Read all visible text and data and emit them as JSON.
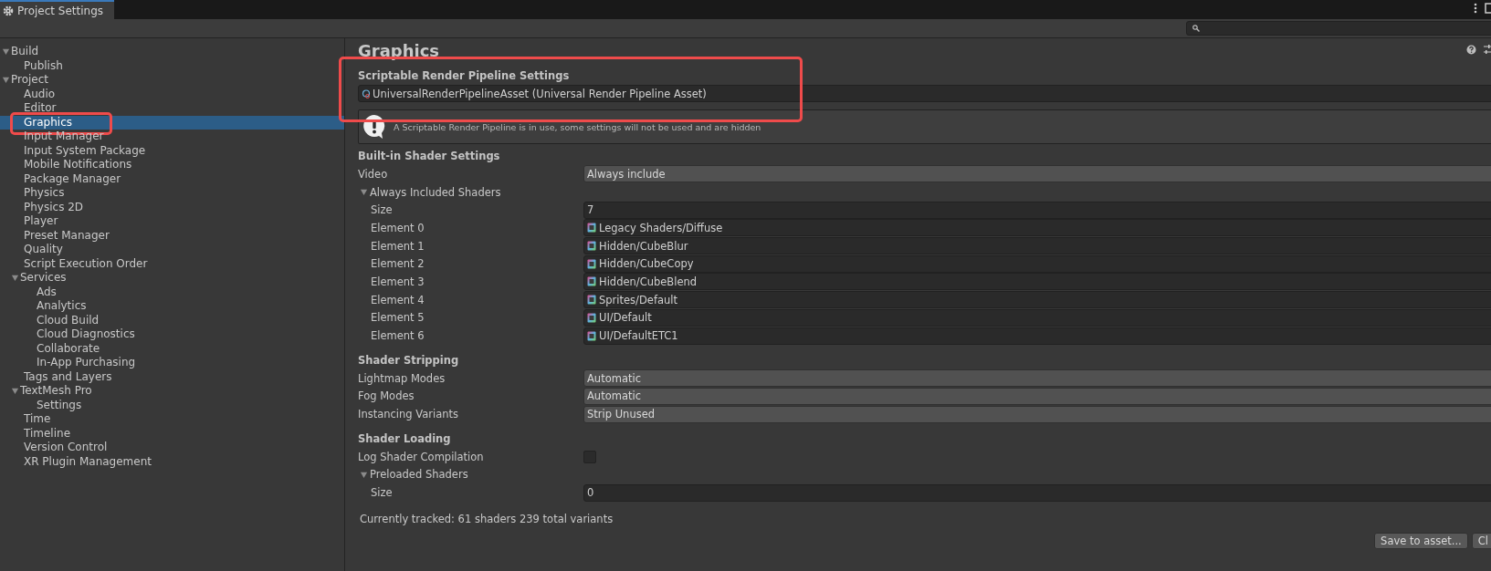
{
  "window": {
    "tab_title": "Project Settings"
  },
  "sidebar": {
    "items": [
      {
        "label": "Build",
        "expanded": true,
        "selected": false,
        "annotated": false,
        "children": [
          {
            "label": "Publish",
            "selected": false,
            "annotated": false
          }
        ]
      },
      {
        "label": "Project",
        "expanded": true,
        "selected": false,
        "annotated": false,
        "children": [
          {
            "label": "Audio",
            "selected": false,
            "annotated": false
          },
          {
            "label": "Editor",
            "selected": false,
            "annotated": false
          },
          {
            "label": "Graphics",
            "selected": true,
            "annotated": true
          },
          {
            "label": "Input Manager",
            "selected": false,
            "annotated": false
          },
          {
            "label": "Input System Package",
            "selected": false,
            "annotated": false
          },
          {
            "label": "Mobile Notifications",
            "selected": false,
            "annotated": false
          },
          {
            "label": "Package Manager",
            "selected": false,
            "annotated": false
          },
          {
            "label": "Physics",
            "selected": false,
            "annotated": false
          },
          {
            "label": "Physics 2D",
            "selected": false,
            "annotated": false
          },
          {
            "label": "Player",
            "selected": false,
            "annotated": false
          },
          {
            "label": "Preset Manager",
            "selected": false,
            "annotated": false
          },
          {
            "label": "Quality",
            "selected": false,
            "annotated": false
          },
          {
            "label": "Script Execution Order",
            "selected": false,
            "annotated": false
          },
          {
            "label": "Services",
            "expanded": true,
            "selected": false,
            "annotated": false,
            "children": [
              {
                "label": "Ads",
                "selected": false,
                "annotated": false
              },
              {
                "label": "Analytics",
                "selected": false,
                "annotated": false
              },
              {
                "label": "Cloud Build",
                "selected": false,
                "annotated": false
              },
              {
                "label": "Cloud Diagnostics",
                "selected": false,
                "annotated": false
              },
              {
                "label": "Collaborate",
                "selected": false,
                "annotated": false
              },
              {
                "label": "In-App Purchasing",
                "selected": false,
                "annotated": false
              }
            ]
          },
          {
            "label": "Tags and Layers",
            "selected": false,
            "annotated": false
          },
          {
            "label": "TextMesh Pro",
            "expanded": true,
            "selected": false,
            "annotated": false,
            "children": [
              {
                "label": "Settings",
                "selected": false,
                "annotated": false
              }
            ]
          },
          {
            "label": "Time",
            "selected": false,
            "annotated": false
          },
          {
            "label": "Timeline",
            "selected": false,
            "annotated": false
          },
          {
            "label": "Version Control",
            "selected": false,
            "annotated": false
          },
          {
            "label": "XR Plugin Management",
            "selected": false,
            "annotated": false
          }
        ]
      }
    ]
  },
  "main": {
    "title": "Graphics",
    "pipeline": {
      "heading": "Scriptable Render Pipeline Settings",
      "asset": "UniversalRenderPipelineAsset (Universal Render Pipeline Asset)",
      "annotated": true
    },
    "info_box": {
      "message": "A Scriptable Render Pipeline is in use, some settings will not be used and are hidden"
    },
    "sections": [
      {
        "heading": "Built-in Shader Settings",
        "rows": [
          {
            "kind": "dropdown",
            "label": "Video",
            "value": "Always include"
          },
          {
            "kind": "foldout",
            "label": "Always Included Shaders",
            "expanded": true,
            "children": [
              {
                "kind": "number",
                "label": "Size",
                "value": "7"
              },
              {
                "kind": "object",
                "label": "Element 0",
                "value": "Legacy Shaders/Diffuse"
              },
              {
                "kind": "object",
                "label": "Element 1",
                "value": "Hidden/CubeBlur"
              },
              {
                "kind": "object",
                "label": "Element 2",
                "value": "Hidden/CubeCopy"
              },
              {
                "kind": "object",
                "label": "Element 3",
                "value": "Hidden/CubeBlend"
              },
              {
                "kind": "object",
                "label": "Element 4",
                "value": "Sprites/Default"
              },
              {
                "kind": "object",
                "label": "Element 5",
                "value": "UI/Default"
              },
              {
                "kind": "object",
                "label": "Element 6",
                "value": "UI/DefaultETC1"
              }
            ]
          }
        ]
      },
      {
        "heading": "Shader Stripping",
        "rows": [
          {
            "kind": "dropdown",
            "label": "Lightmap Modes",
            "value": "Automatic"
          },
          {
            "kind": "dropdown",
            "label": "Fog Modes",
            "value": "Automatic"
          },
          {
            "kind": "dropdown",
            "label": "Instancing Variants",
            "value": "Strip Unused"
          }
        ]
      },
      {
        "heading": "Shader Loading",
        "rows": [
          {
            "kind": "checkbox",
            "label": "Log Shader Compilation",
            "checked": false
          },
          {
            "kind": "foldout",
            "label": "Preloaded Shaders",
            "expanded": true,
            "children": [
              {
                "kind": "number",
                "label": "Size",
                "value": "0"
              }
            ]
          }
        ]
      }
    ],
    "tracked": "Currently tracked: 61 shaders 239 total variants",
    "buttons": [
      "Save to asset...",
      "Cl"
    ]
  }
}
